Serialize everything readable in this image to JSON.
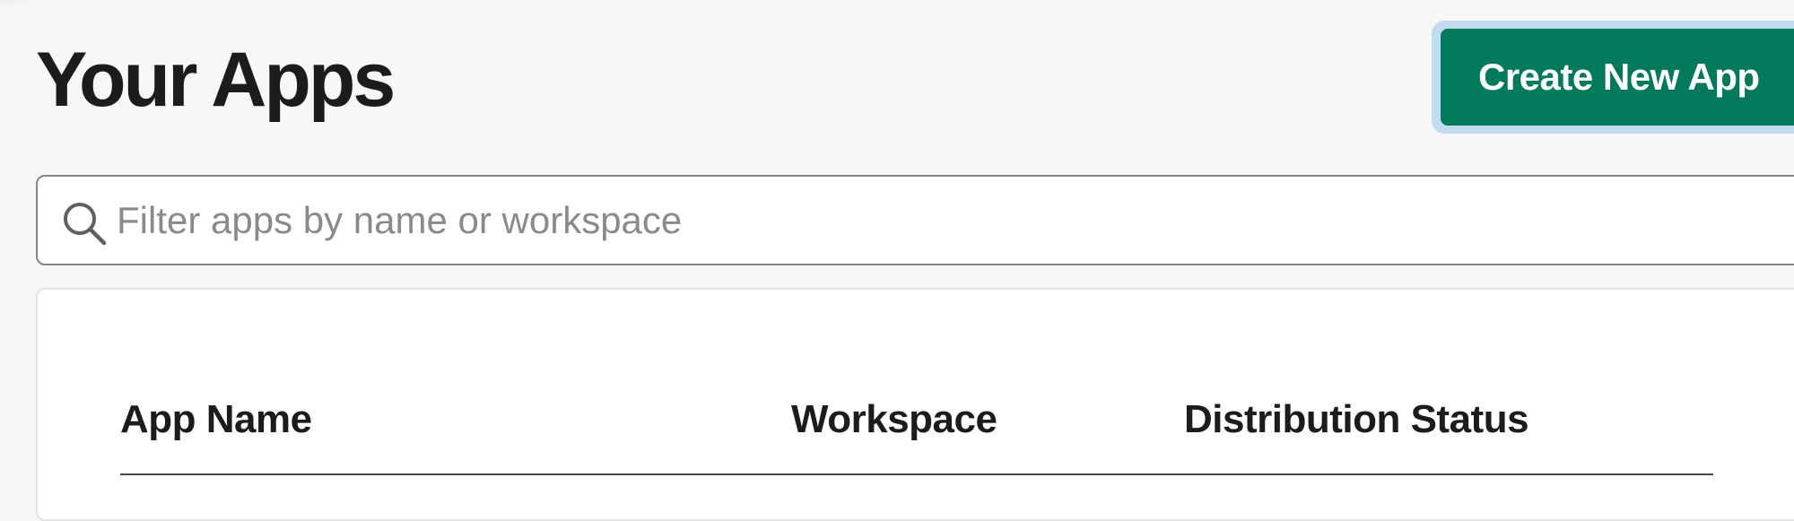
{
  "page": {
    "title": "Your Apps"
  },
  "toolbar": {
    "create_label": "Create New App"
  },
  "search": {
    "placeholder": "Filter apps by name or workspace",
    "value": ""
  },
  "table": {
    "columns": [
      "App Name",
      "Workspace",
      "Distribution Status"
    ]
  },
  "colors": {
    "primary_button": "#007a5a",
    "focus_ring": "#c2dcef",
    "background": "#f7f7f7"
  }
}
